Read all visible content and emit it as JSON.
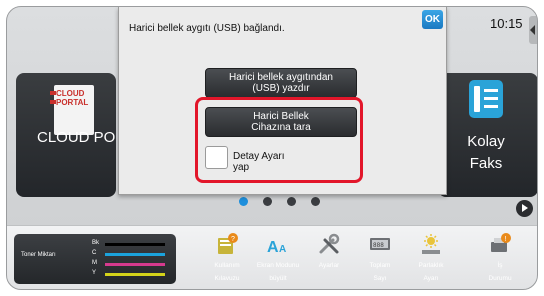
{
  "status": {
    "clock": "10:15"
  },
  "home": {
    "left_tile": {
      "logo_text": [
        "CLOUD",
        "PORTAL"
      ],
      "label": "CLOUD POR"
    },
    "right_tile": {
      "label_line1": "Kolay",
      "label_line2": "Faks"
    },
    "page_dots": 4,
    "active_page": 1
  },
  "dialog": {
    "message": "Harici bellek aygıtı (USB) bağlandı.",
    "ok_label": "OK",
    "print_button": {
      "line1": "Harici bellek aygıtından",
      "line2": "(USB) yazdır"
    },
    "scan_button": {
      "line1": "Harici Bellek",
      "line2": "Cihazına tara"
    },
    "detail": {
      "line1": "Detay Ayarı",
      "line2": "yap",
      "checked": false
    }
  },
  "bottom_bar": {
    "toner": {
      "title": "Toner Miktarı",
      "rows": [
        {
          "key": "Bk",
          "color": "#000000",
          "level": 1.0
        },
        {
          "key": "C",
          "color": "#1ba3dd",
          "level": 1.0
        },
        {
          "key": "M",
          "color": "#d63a8e",
          "level": 1.0
        },
        {
          "key": "Y",
          "color": "#d4d31a",
          "level": 1.0
        }
      ]
    },
    "tools": [
      {
        "name": "user-guide",
        "line1": "Kullanım",
        "line2": "Kılavuzu"
      },
      {
        "name": "screen-zoom",
        "line1": "Ekran Modunu",
        "line2": "büyült"
      },
      {
        "name": "settings",
        "line1": "Ayarlar",
        "line2": ""
      },
      {
        "name": "total-count",
        "line1": "Toplam",
        "line2": "Sayı"
      },
      {
        "name": "brightness",
        "line1": "Parlaklık",
        "line2": "Ayarı"
      },
      {
        "name": "job-status",
        "line1": "İş",
        "line2": "Durumu"
      }
    ]
  },
  "colors": {
    "highlight": "#e2162a",
    "ok_blue": "#1a79c2",
    "tile_dark": "#2b2e32"
  }
}
